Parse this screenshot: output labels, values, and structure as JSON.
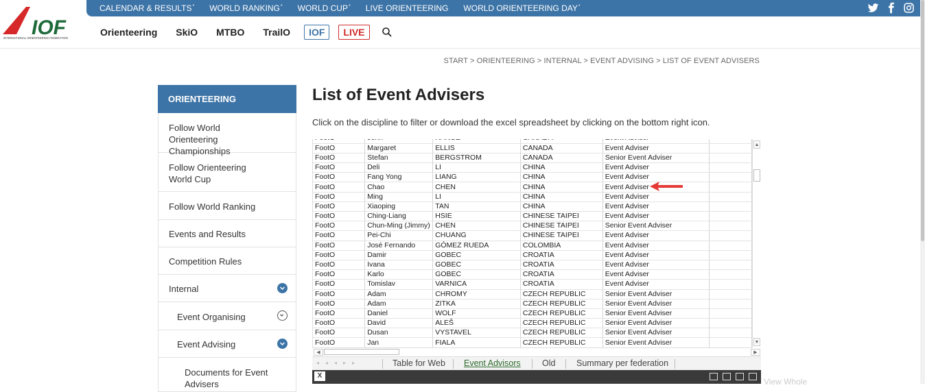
{
  "brand": {
    "logo_text": "IOF",
    "logo_subtitle": "INTERNATIONAL ORIENTEERING FEDERATION",
    "accent": "#3d74a7",
    "logo_red": "#d62828",
    "logo_green": "#1e6a3a"
  },
  "topbar": {
    "links": [
      {
        "label": "CALENDAR & RESULTS",
        "star": "*"
      },
      {
        "label": "WORLD RANKING",
        "star": "*"
      },
      {
        "label": "WORLD CUP",
        "star": "*"
      },
      {
        "label": "LIVE ORIENTEERING",
        "star": ""
      },
      {
        "label": "WORLD ORIENTEERING DAY",
        "star": "*"
      }
    ],
    "social_icons": [
      "twitter-icon",
      "facebook-icon",
      "instagram-icon"
    ]
  },
  "mainnav": {
    "items": [
      "Orienteering",
      "SkiO",
      "MTBO",
      "TrailO"
    ],
    "iof_badge": "IOF",
    "live_badge": "LIVE",
    "search_icon": "search-icon"
  },
  "breadcrumb": "START > ORIENTEERING > INTERNAL > EVENT ADVISING > LIST OF EVENT ADVISERS",
  "sidebar": {
    "heading": "ORIENTEERING",
    "items": [
      {
        "label": "Follow World Orienteering Championships",
        "chevron": ""
      },
      {
        "label": "Follow Orienteering World Cup",
        "chevron": ""
      },
      {
        "label": "Follow World Ranking",
        "chevron": ""
      },
      {
        "label": "Events and Results",
        "chevron": ""
      },
      {
        "label": "Competition Rules",
        "chevron": ""
      },
      {
        "label": "Internal",
        "chevron": "filled"
      },
      {
        "label": "Event Organising",
        "chevron": "outline"
      },
      {
        "label": "Event Advising",
        "chevron": "filled"
      },
      {
        "label": "Documents for Event Advisers",
        "chevron": ""
      }
    ]
  },
  "main": {
    "title": "List of Event Advisers",
    "intro": "Click on the discipline to filter or download the excel spreadsheet by clicking on the bottom right icon."
  },
  "spreadsheet": {
    "rows": [
      [
        "FootO",
        "John",
        "RANCE",
        "CANADA",
        "Event Adviser"
      ],
      [
        "FootO",
        "Margaret",
        "ELLIS",
        "CANADA",
        "Event Adviser"
      ],
      [
        "FootO",
        "Stefan",
        "BERGSTROM",
        "CANADA",
        "Senior Event Adviser"
      ],
      [
        "FootO",
        "Deli",
        "LI",
        "CHINA",
        "Event Adviser"
      ],
      [
        "FootO",
        "Fang Yong",
        "LIANG",
        "CHINA",
        "Event Adviser"
      ],
      [
        "FootO",
        "Chao",
        "CHEN",
        "CHINA",
        "Event Adviser"
      ],
      [
        "FootO",
        "Ming",
        "LI",
        "CHINA",
        "Event Adviser"
      ],
      [
        "FootO",
        "Xiaoping",
        "TAN",
        "CHINA",
        "Event Adviser"
      ],
      [
        "FootO",
        "Ching-Liang",
        "HSIE",
        "CHINESE TAIPEI",
        "Event Adviser"
      ],
      [
        "FootO",
        "Chun-Ming (Jimmy)",
        "CHEN",
        "CHINESE TAIPEI",
        "Senior Event Adviser"
      ],
      [
        "FootO",
        "Pei-Chi",
        "CHUANG",
        "CHINESE TAIPEI",
        "Event Adviser"
      ],
      [
        "FootO",
        "José Fernando",
        "GÓMEZ RUEDA",
        "COLOMBIA",
        "Event Adviser"
      ],
      [
        "FootO",
        "Damir",
        "GOBEC",
        "CROATIA",
        "Event Adviser"
      ],
      [
        "FootO",
        "Ivana",
        "GOBEC",
        "CROATIA",
        "Event Adviser"
      ],
      [
        "FootO",
        "Karlo",
        "GOBEC",
        "CROATIA",
        "Event Adviser"
      ],
      [
        "FootO",
        "Tomislav",
        "VARNICA",
        "CROATIA",
        "Event Adviser"
      ],
      [
        "FootO",
        "Adam",
        "CHROMY",
        "CZECH REPUBLIC",
        "Senior Event Adviser"
      ],
      [
        "FootO",
        "Adam",
        "ZITKA",
        "CZECH REPUBLIC",
        "Senior Event Adviser"
      ],
      [
        "FootO",
        "Daniel",
        "WOLF",
        "CZECH REPUBLIC",
        "Senior Event Adviser"
      ],
      [
        "FootO",
        "David",
        "ALEŠ",
        "CZECH REPUBLIC",
        "Senior Event Adviser"
      ],
      [
        "FootO",
        "Dusan",
        "VYSTAVEL",
        "CZECH REPUBLIC",
        "Senior Event Adviser"
      ],
      [
        "FootO",
        "Jan",
        "FIALA",
        "CZECH REPUBLIC",
        "Senior Event Adviser"
      ]
    ],
    "highlighted_row": 5,
    "sheet_tabs": [
      "Table for Web",
      "Event Advisors",
      "Old",
      "Summary per federation"
    ],
    "active_tab": "Event Advisors",
    "excel_icon": "X",
    "arrow_color": "#e53935"
  },
  "ghost_text": "View Whole"
}
